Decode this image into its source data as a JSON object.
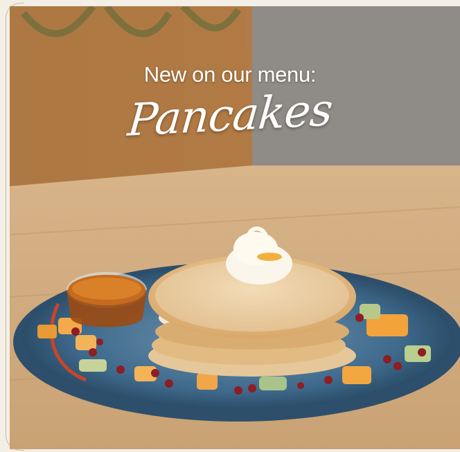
{
  "promo": {
    "subtitle": "New on our menu:",
    "title": "Pancakes"
  },
  "photo": {
    "subject": "stack of pancakes with banana slices, whipped butter, syrup cup and fruit on a blue plate",
    "colors": {
      "wood_table": "#d9b48a",
      "plate_blue": "#3d6b8f",
      "pancake": "#e9c48f",
      "frame_line": "#c7b9a0"
    }
  }
}
